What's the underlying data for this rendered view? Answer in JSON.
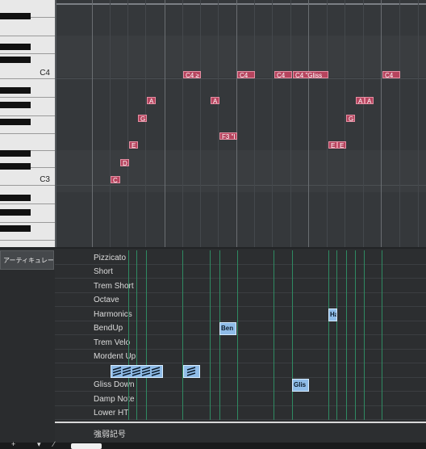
{
  "piano": {
    "labels": [
      "C4",
      "C3"
    ]
  },
  "roll": {
    "notes": [
      {
        "label": "C4 ≥",
        "x": 0,
        "w": 0
      },
      {
        "label": "C4",
        "x": 0,
        "w": 0
      },
      {
        "label": "C4",
        "x": 0,
        "w": 0
      },
      {
        "label": "C4 \"Gliss",
        "x": 0,
        "w": 0
      },
      {
        "label": "C4",
        "x": 0,
        "w": 0
      },
      {
        "label": "A",
        "x": 0,
        "w": 0
      },
      {
        "label": "A",
        "x": 0,
        "w": 0
      },
      {
        "label": "A",
        "x": 0,
        "w": 0
      },
      {
        "label": "A",
        "x": 0,
        "w": 0
      },
      {
        "label": "G",
        "x": 0,
        "w": 0
      },
      {
        "label": "G",
        "x": 0,
        "w": 0
      },
      {
        "label": "F3 \"I",
        "x": 0,
        "w": 0
      },
      {
        "label": "E",
        "x": 0,
        "w": 0
      },
      {
        "label": "E",
        "x": 0,
        "w": 0
      },
      {
        "label": "E",
        "x": 0,
        "w": 0
      },
      {
        "label": "D",
        "x": 0,
        "w": 0
      },
      {
        "label": "C",
        "x": 0,
        "w": 0
      }
    ]
  },
  "articulation": {
    "tab_label": "アーティキュレーション",
    "lanes": [
      "Pizzicato",
      "Short",
      "Trem Short",
      "Octave",
      "Harmonics",
      "BendUp",
      "Trem Velo",
      "Mordent Up",
      "",
      "Gliss Down",
      "Damp Note",
      "Lower HT"
    ],
    "events": [
      {
        "label": "Ha"
      },
      {
        "label": "Ben"
      },
      {
        "label": "Glis"
      }
    ],
    "dynamics_label": "強弱記号"
  },
  "colors": {
    "note_fill": "#b6445e",
    "event_fill": "#8fbce8",
    "tick_green": "#2f8a62"
  }
}
